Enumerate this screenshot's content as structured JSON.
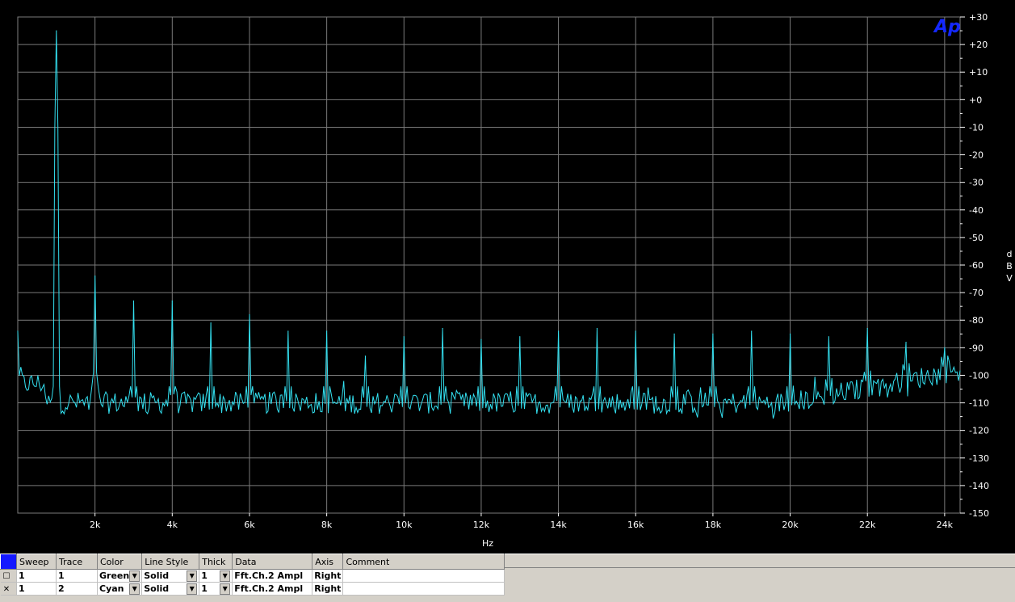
{
  "logo": "Ap",
  "chart_data": {
    "type": "line",
    "title": "",
    "xlabel": "Hz",
    "ylabel": "dBV",
    "xlim": [
      0,
      24400
    ],
    "ylim": [
      -150,
      30
    ],
    "x_ticks": [
      "2k",
      "4k",
      "6k",
      "8k",
      "10k",
      "12k",
      "14k",
      "16k",
      "18k",
      "20k",
      "22k",
      "24k"
    ],
    "x_tick_values": [
      2000,
      4000,
      6000,
      8000,
      10000,
      12000,
      14000,
      16000,
      18000,
      20000,
      22000,
      24000
    ],
    "y_ticks": [
      "+30",
      "+20",
      "+10",
      "+0",
      "-10",
      "-20",
      "-30",
      "-40",
      "-50",
      "-60",
      "-70",
      "-80",
      "-90",
      "-100",
      "-110",
      "-120",
      "-130",
      "-140",
      "-150"
    ],
    "y_tick_values": [
      30,
      20,
      10,
      0,
      -10,
      -20,
      -30,
      -40,
      -50,
      -60,
      -70,
      -80,
      -90,
      -100,
      -110,
      -120,
      -130,
      -140,
      -150
    ],
    "grid": true,
    "y_axis_side": "right",
    "series": [
      {
        "color": "#33e0f0",
        "noise_floor": -110,
        "peaks": [
          {
            "x": 0,
            "y": -84
          },
          {
            "x": 1000,
            "y": 25
          },
          {
            "x": 2000,
            "y": -64
          },
          {
            "x": 3000,
            "y": -73
          },
          {
            "x": 4000,
            "y": -73
          },
          {
            "x": 5000,
            "y": -81
          },
          {
            "x": 6000,
            "y": -78
          },
          {
            "x": 7000,
            "y": -84
          },
          {
            "x": 8000,
            "y": -84
          },
          {
            "x": 9000,
            "y": -93
          },
          {
            "x": 10000,
            "y": -86
          },
          {
            "x": 11000,
            "y": -83
          },
          {
            "x": 12000,
            "y": -87
          },
          {
            "x": 13000,
            "y": -86
          },
          {
            "x": 14000,
            "y": -84
          },
          {
            "x": 15000,
            "y": -83
          },
          {
            "x": 16000,
            "y": -84
          },
          {
            "x": 17000,
            "y": -85
          },
          {
            "x": 18000,
            "y": -85
          },
          {
            "x": 19000,
            "y": -84
          },
          {
            "x": 20000,
            "y": -85
          },
          {
            "x": 21000,
            "y": -86
          },
          {
            "x": 22000,
            "y": -83
          },
          {
            "x": 23000,
            "y": -88
          },
          {
            "x": 24000,
            "y": -90
          }
        ]
      }
    ]
  },
  "legend": {
    "headers": [
      "Sweep",
      "Trace",
      "Color",
      "Line Style",
      "Thick",
      "Data",
      "Axis",
      "Comment"
    ],
    "rows": [
      {
        "sweep": "1",
        "trace": "1",
        "color": "Green",
        "style": "Solid",
        "thick": "1",
        "data": "Fft.Ch.2 Ampl",
        "axis": "Right",
        "comment": ""
      },
      {
        "sweep": "1",
        "trace": "2",
        "color": "Cyan",
        "style": "Solid",
        "thick": "1",
        "data": "Fft.Ch.2 Ampl",
        "axis": "Right",
        "comment": ""
      }
    ]
  }
}
